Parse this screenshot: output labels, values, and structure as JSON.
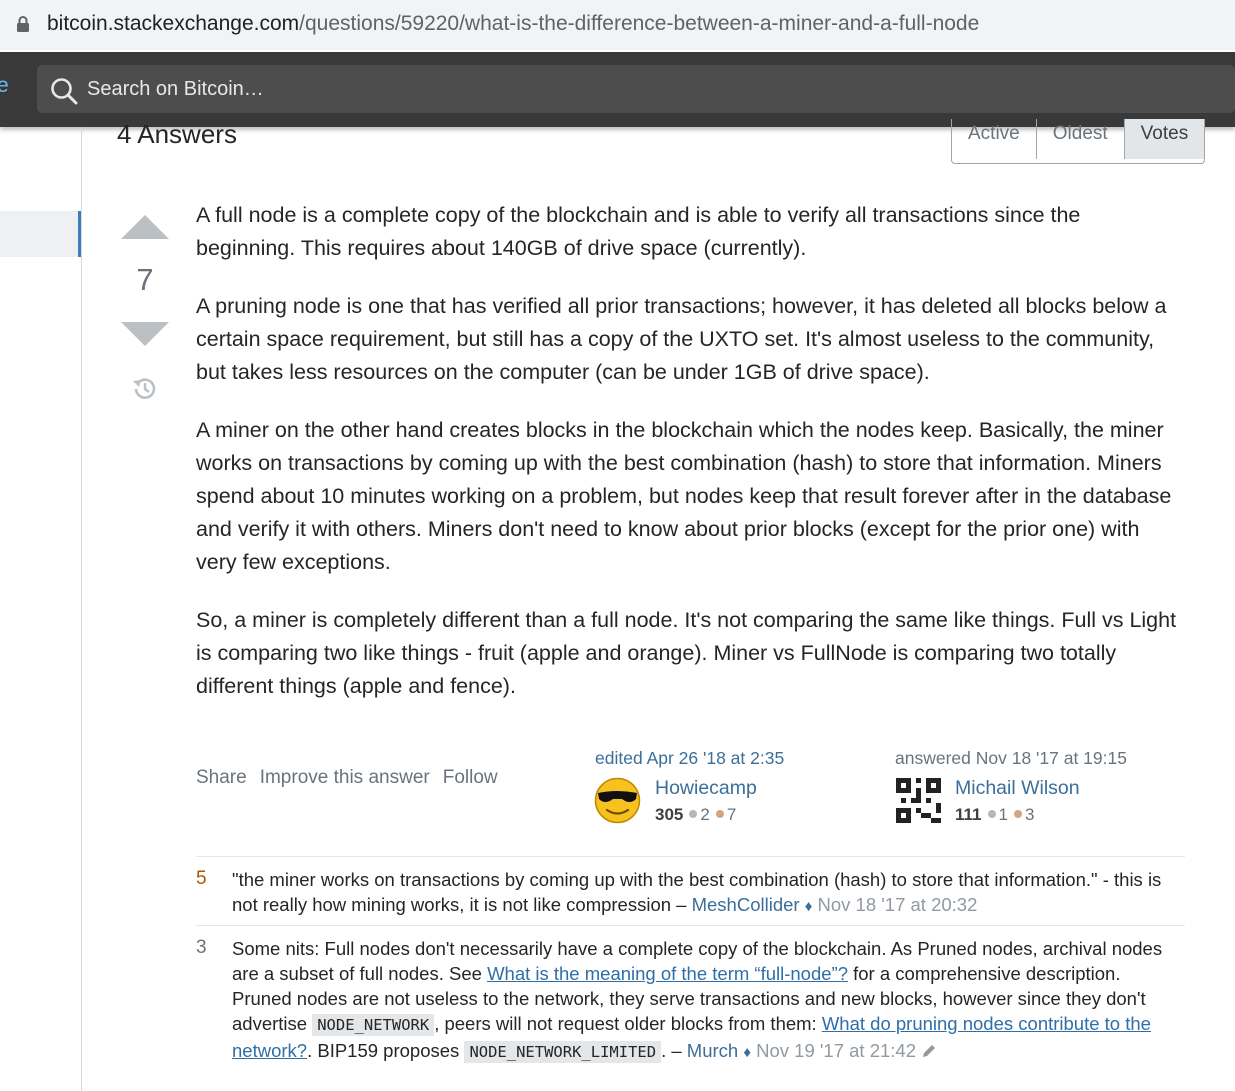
{
  "browser": {
    "url_host": "bitcoin.stackexchange.com",
    "url_path": "/questions/59220/what-is-the-difference-between-a-miner-and-a-full-node"
  },
  "topbar": {
    "left_edge_text": "e",
    "search_placeholder": "Search on Bitcoin…"
  },
  "answers_header": {
    "title": "4 Answers",
    "sort_tabs": [
      "Active",
      "Oldest",
      "Votes"
    ],
    "selected_sort": "Votes"
  },
  "answer": {
    "vote_count": "7",
    "paragraphs": [
      "A full node is a complete copy of the blockchain and is able to verify all transactions since the beginning. This requires about 140GB of drive space (currently).",
      "A pruning node is one that has verified all prior transactions; however, it has deleted all blocks below a certain space requirement, but still has a copy of the UXTO set. It's almost useless to the community, but takes less resources on the computer (can be under 1GB of drive space).",
      "A miner on the other hand creates blocks in the blockchain which the nodes keep. Basically, the miner works on transactions by coming up with the best combination (hash) to store that information. Miners spend about 10 minutes working on a problem, but nodes keep that result forever after in the database and verify it with others. Miners don't need to know about prior blocks (except for the prior one) with very few exceptions.",
      "So, a miner is completely different than a full node. It's not comparing the same like things. Full vs Light is comparing two like things - fruit (apple and orange). Miner vs FullNode is comparing two totally different things (apple and fence)."
    ],
    "menu": {
      "share": "Share",
      "improve": "Improve this answer",
      "follow": "Follow"
    },
    "editor": {
      "action": "edited Apr 26 '18 at 2:35",
      "name": "Howiecamp",
      "reputation": "305",
      "silver": "2",
      "bronze": "7"
    },
    "author": {
      "action": "answered Nov 18 '17 at 19:15",
      "name": "Michail Wilson",
      "reputation": "111",
      "silver": "1",
      "bronze": "3"
    }
  },
  "comments": [
    {
      "score": "5",
      "text": "\"the miner works on transactions by coming up with the best combination (hash) to store that information.\" - this is not really how mining works, it is not like compression –",
      "user": "MeshCollider",
      "diamond": "♦",
      "date": "Nov 18 '17 at 20:32"
    },
    {
      "score": "3",
      "text_1": "Some nits: Full nodes don't necessarily have a complete copy of the blockchain. As Pruned nodes, archival nodes are a subset of full nodes. See",
      "link_1": "What is the meaning of the term “full-node”?",
      "text_2": "for a comprehensive description. Pruned nodes are not useless to the network, they serve transactions and new blocks, however since they don't advertise",
      "code_1": "NODE_NETWORK",
      "text_3": ", peers will not request older blocks from them:",
      "link_2": "What do pruning nodes contribute to the network?",
      "text_4": ". BIP159 proposes",
      "code_2": "NODE_NETWORK_LIMITED",
      "text_5": ". –",
      "user": "Murch",
      "diamond": "♦",
      "date": "Nov 19 '17 at 21:42"
    }
  ],
  "colors": {
    "link": "#3b6e99",
    "silver_badge": "#b4b8bc",
    "bronze_badge": "#d1a684",
    "score_highlight": "#a65a00",
    "topbar": "#393939"
  }
}
